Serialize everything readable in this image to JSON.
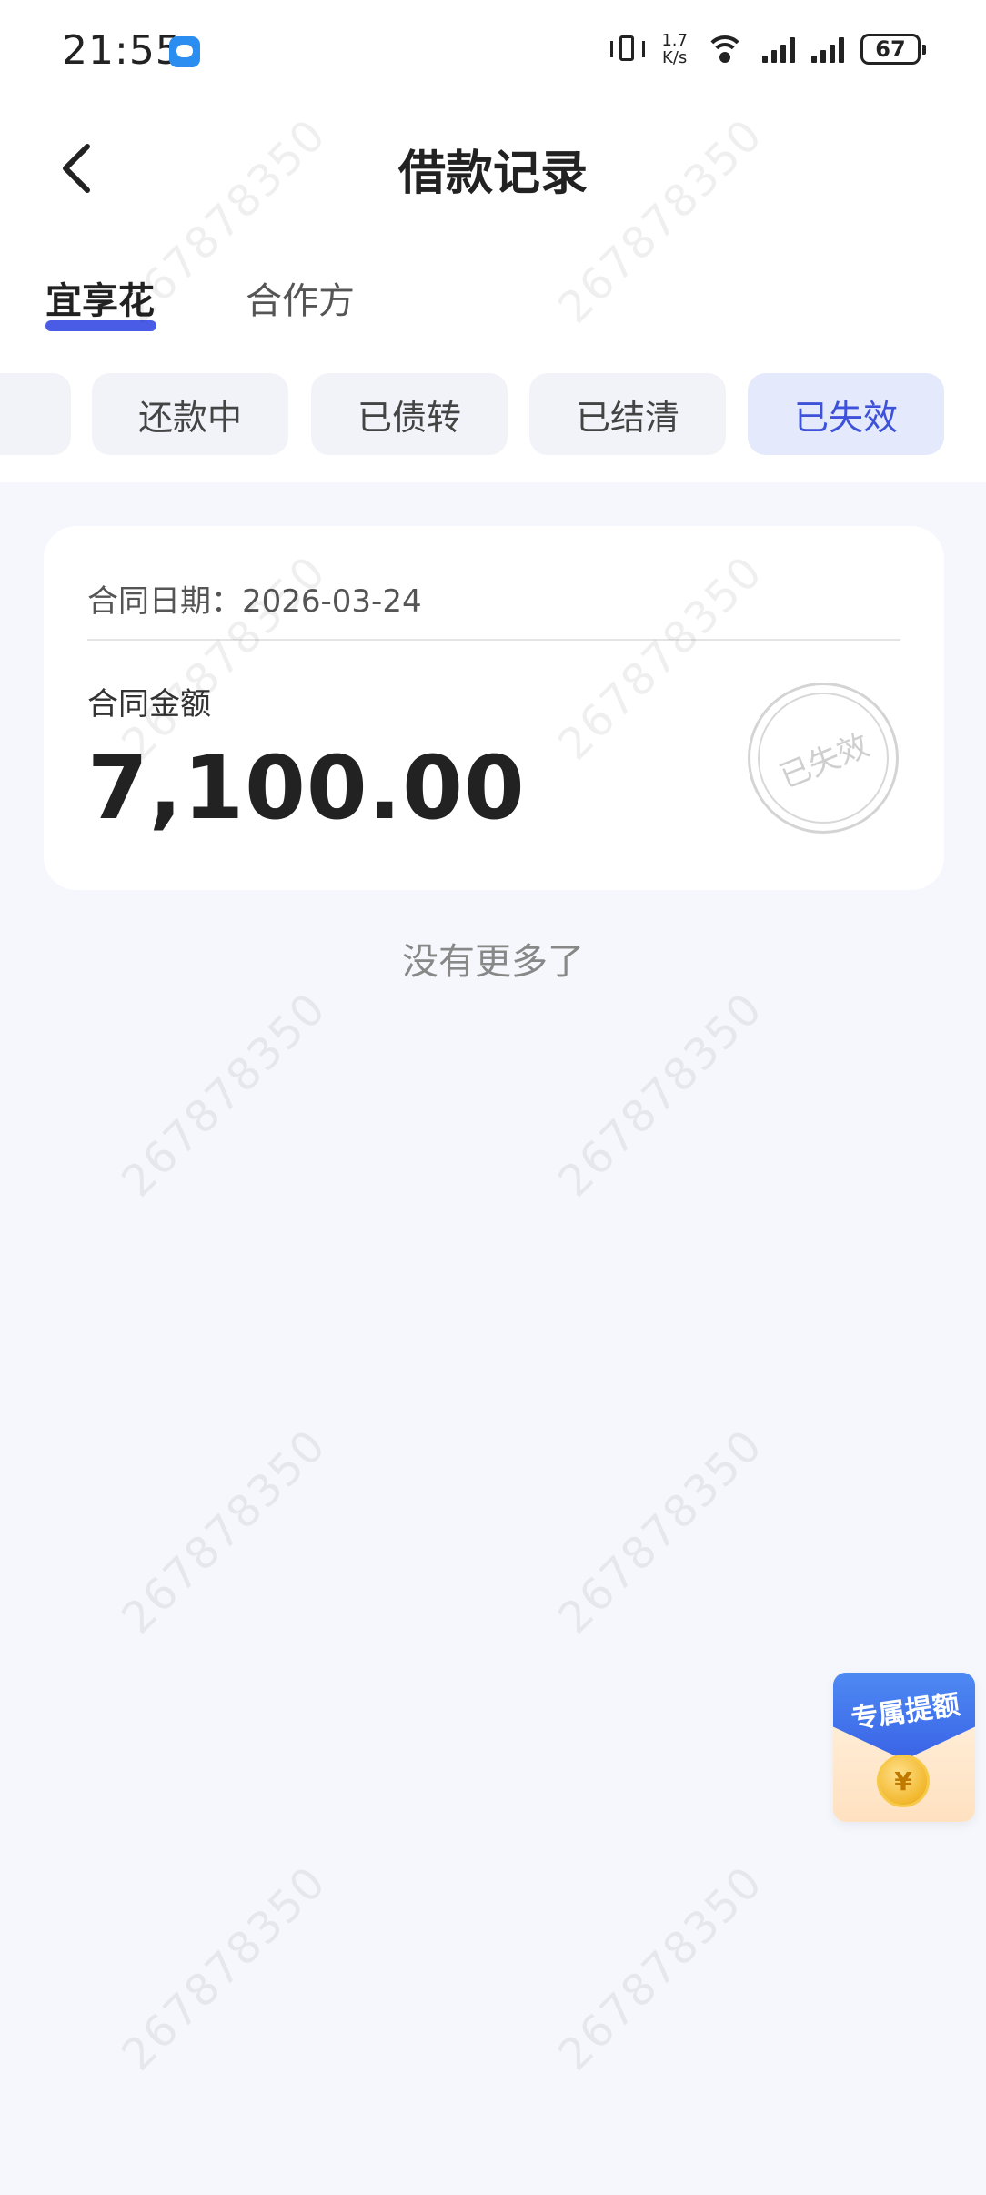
{
  "status_bar": {
    "time": "21:55",
    "net_speed_value": "1.7",
    "net_speed_unit": "K/s",
    "battery": "67"
  },
  "header": {
    "title": "借款记录",
    "back_icon": "chevron-left-icon"
  },
  "main_tabs": [
    {
      "label": "宜享花",
      "active": true
    },
    {
      "label": "合作方",
      "active": false
    }
  ],
  "filters": [
    {
      "label": "还款中",
      "active": false
    },
    {
      "label": "已债转",
      "active": false
    },
    {
      "label": "已结清",
      "active": false
    },
    {
      "label": "已失效",
      "active": true
    }
  ],
  "record": {
    "date_label": "合同日期：",
    "date_value": "2026-03-24",
    "amount_label": "合同金额",
    "amount": "7,100.00",
    "stamp": "已失效"
  },
  "footer_text": "没有更多了",
  "promo": {
    "label": "专属提额",
    "coin_symbol": "¥"
  },
  "watermark": "267878350",
  "colors": {
    "accent": "#4a5ce6",
    "chip_active_bg": "#e4e9fb",
    "chip_active_text": "#3e52d9",
    "page_bg": "#f5f7fc"
  }
}
